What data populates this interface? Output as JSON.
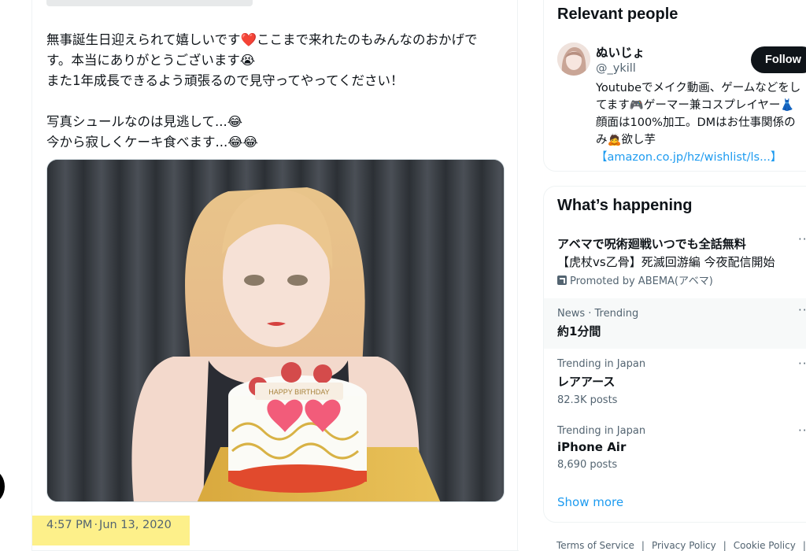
{
  "tweet": {
    "lines": [
      "無事誕生日迎えられて嬉しいです❤️ここまで来れたのもみんなのおかげで\nす。本当にありがとうございます😭\nまた1年成長できるよう頑張るので見守ってやってください！",
      "写真シュールなのは見逃して...😂\n今から寂しくケーキ食べます...😂😂"
    ],
    "timestamp_time": "4:57 PM",
    "timestamp_sep": "·",
    "timestamp_date": "Jun 13, 2020",
    "photo": {
      "cake_plaque": "HAPPY BIRTHDAY"
    }
  },
  "relevant_people": {
    "title": "Relevant people",
    "person": {
      "name": "ぬいじょ",
      "handle": "@_ykill",
      "follow_label": "Follow",
      "bio_lines": [
        "Youtubeでメイク動画、ゲームなどをし",
        "てます🎮ゲーマー兼コスプレイヤー👗",
        "顔面は100%加工。DMはお仕事関係の",
        "み🙇欲し芋"
      ],
      "bio_link": "【amazon.co.jp/hz/wishlist/ls...】"
    }
  },
  "whats_happening": {
    "title": "What’s happening",
    "more_icon": "···",
    "trends": [
      {
        "title": "アベマで呪術廻戦いつでも全話無料",
        "subtitle": "【虎杖vs乙骨】死滅回游編 今夜配信開始",
        "promoted": "Promoted by ABEMA(アベマ)"
      },
      {
        "meta": "News · Trending",
        "title": "約1分間"
      },
      {
        "meta": "Trending in Japan",
        "title": "レアアース",
        "posts": "82.3K posts"
      },
      {
        "meta": "Trending in Japan",
        "title": "iPhone Air",
        "posts": "8,690 posts"
      }
    ],
    "show_more": "Show more"
  },
  "footer": {
    "links": [
      "Terms of Service",
      "Privacy Policy",
      "Cookie Policy"
    ],
    "separator": "|"
  },
  "colors": {
    "accent": "#1d9bf0",
    "highlight": "#fdf08a",
    "hover_row": "#f7f9f9"
  }
}
